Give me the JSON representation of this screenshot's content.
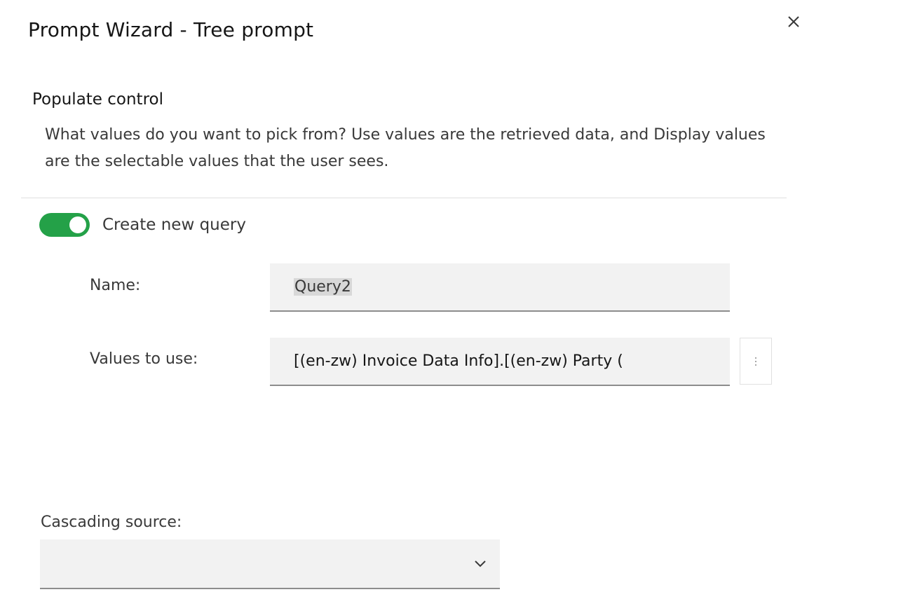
{
  "dialog": {
    "title": "Prompt Wizard - Tree prompt",
    "close_icon": "close-icon"
  },
  "populate_control": {
    "heading": "Populate control",
    "description": "What values do you want to pick from? Use values are the retrieved data, and Display values are the selectable values that the user sees."
  },
  "create_query": {
    "label": "Create new query",
    "enabled": true,
    "toggle_color": "#24a148"
  },
  "fields": {
    "name_label": "Name:",
    "name_value": "Query2",
    "values_label": "Values to use:",
    "values_value": "[(en-zw) Invoice Data Info].[(en-zw) Party (",
    "more_icon": "overflow-menu-vertical-icon"
  },
  "cascading": {
    "label": "Cascading source:",
    "selected": "",
    "chevron_icon": "chevron-down-icon"
  }
}
